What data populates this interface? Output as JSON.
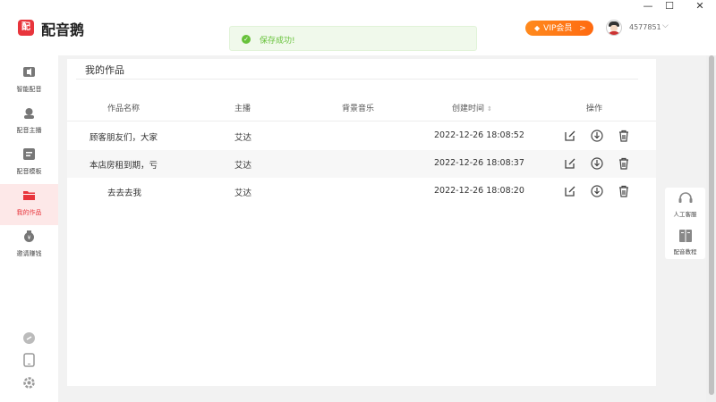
{
  "app": {
    "title": "配音鹅",
    "logo_text": "配"
  },
  "header": {
    "vip_label": "VIP会员",
    "vip_arrow": ">",
    "user_id": "4577851",
    "user_chevron": "⌵",
    "window_controls": [
      "—",
      "☐",
      "✕"
    ]
  },
  "toast": {
    "text": "保存成功!",
    "icon": "check-icon"
  },
  "sidebar": {
    "items": [
      {
        "label": "智能配音",
        "icon": "speaker-icon"
      },
      {
        "label": "配音主播",
        "icon": "anchor-icon"
      },
      {
        "label": "配音模板",
        "icon": "template-icon"
      },
      {
        "label": "我的作品",
        "icon": "folder-icon",
        "active": true
      },
      {
        "label": "邀请赚钱",
        "icon": "money-bag-icon"
      }
    ],
    "bottom_icons": [
      "link-icon",
      "mobile-icon",
      "settings-icon"
    ]
  },
  "main": {
    "title": "我的作品",
    "columns": [
      "作品名称",
      "主播",
      "背景音乐",
      "创建时间",
      "操作"
    ],
    "sort_icon": "⇕",
    "rows": [
      {
        "name": "顾客朋友们，大家",
        "anchor": "艾达",
        "music": "",
        "created": "2022-12-26 18:08:52"
      },
      {
        "name": "本店房租到期，亏",
        "anchor": "艾达",
        "music": "",
        "created": "2022-12-26 18:08:37"
      },
      {
        "name": "去去去我",
        "anchor": "艾达",
        "music": "",
        "created": "2022-12-26 18:08:20"
      }
    ],
    "row_actions": [
      "edit-icon",
      "download-icon",
      "delete-icon"
    ]
  },
  "float_panel": {
    "items": [
      {
        "label": "人工客服",
        "icon": "headset-icon"
      },
      {
        "label": "配音教程",
        "icon": "book-icon"
      }
    ]
  }
}
